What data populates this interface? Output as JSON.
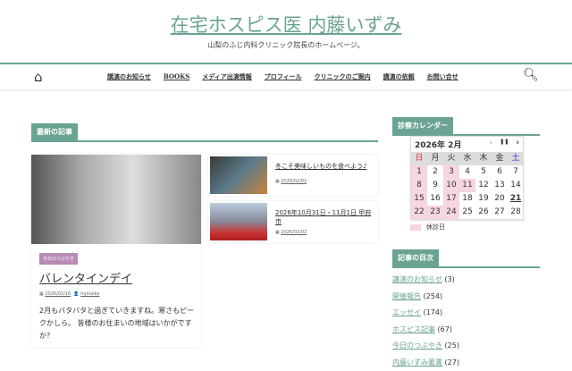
{
  "site": {
    "title": "在宅ホスピス医 内藤いずみ",
    "tagline": "山梨のふじ内科クリニック院長のホームページ。"
  },
  "nav": [
    "講演のお知らせ",
    "BOOKS",
    "メディア出演情報",
    "プロフィール",
    "クリニックのご案内",
    "講演の依頼",
    "お問い合せ"
  ],
  "latest": {
    "heading": "最新の記事",
    "main": {
      "category": "今日のつぶやき",
      "title": "バレンタインデイ",
      "date": "2026/02/16",
      "author": "fujinaika",
      "excerpt": "2月もバタバタと過ぎていきますね。寒さもピークかしら。 皆様のお住まいの地域はいかがですか？"
    },
    "side": [
      {
        "title": "冬こそ美味しいものを食べよう♪",
        "date": "2026/02/02"
      },
      {
        "title": "2026年10月31日・11月1日 甲府市",
        "date": "2026/02/02"
      }
    ]
  },
  "calendar": {
    "heading": "診察カレンダー",
    "month": "2026年 2月",
    "prev": "‹",
    "pause": "❚❚",
    "next": "›",
    "dow": [
      "日",
      "月",
      "火",
      "水",
      "木",
      "金",
      "土"
    ],
    "days": [
      1,
      2,
      3,
      4,
      5,
      6,
      7,
      8,
      9,
      10,
      11,
      12,
      13,
      14,
      15,
      16,
      17,
      18,
      19,
      20,
      21,
      22,
      23,
      24,
      25,
      26,
      27,
      28
    ],
    "holidays": [
      1,
      3,
      8,
      10,
      11,
      15,
      17,
      22,
      23,
      24
    ],
    "today": 21,
    "legend": "休診日",
    "sun_color": "#d33",
    "sat_color": "#33c"
  },
  "categories": {
    "heading": "記事の目次",
    "items": [
      {
        "name": "講演のお知らせ",
        "count": "(3)"
      },
      {
        "name": "開催報告",
        "count": "(254)"
      },
      {
        "name": "エッセイ",
        "count": "(174)"
      },
      {
        "name": "ホスピス記事",
        "count": "(67)"
      },
      {
        "name": "今日のつぶやき",
        "count": "(25)"
      },
      {
        "name": "内藤いずみ著書",
        "count": "(27)"
      }
    ]
  }
}
